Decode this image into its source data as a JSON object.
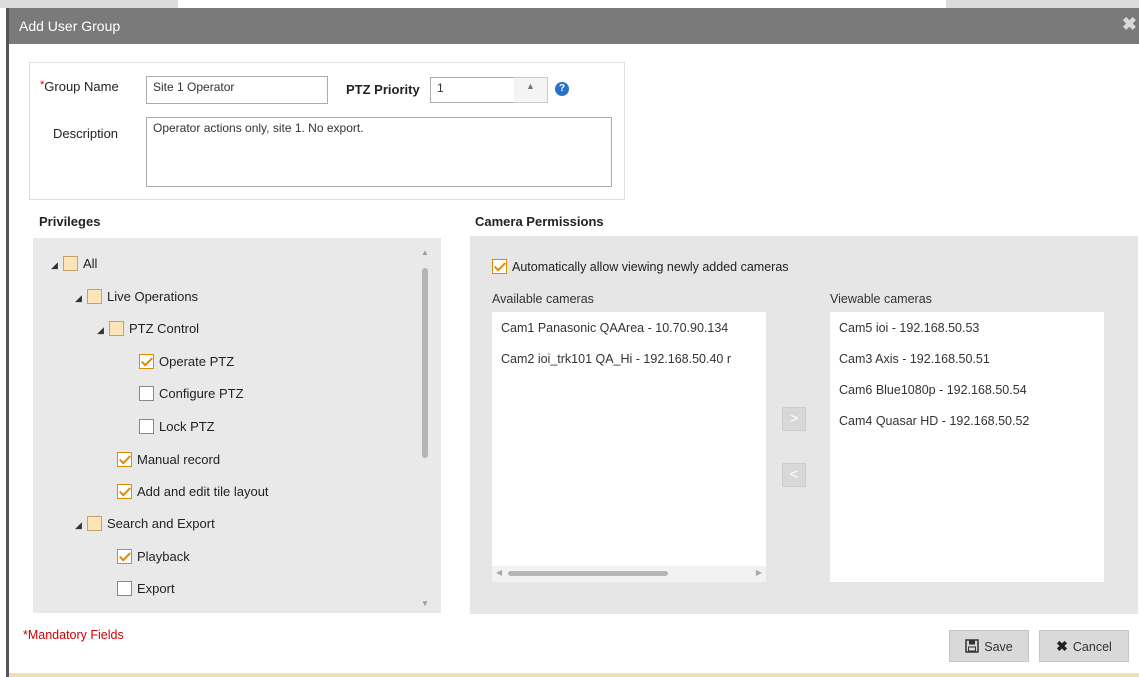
{
  "dialog": {
    "title": "Add User Group",
    "close_glyph": "✖"
  },
  "form": {
    "group_name_label": "Group Name",
    "required_mark": "*",
    "group_name_value": "Site 1 Operator",
    "ptz_priority_label": "PTZ Priority",
    "ptz_priority_value": "1",
    "description_label": "Description",
    "description_value": "Operator actions only, site 1. No export.",
    "help_glyph": "?"
  },
  "privileges": {
    "heading": "Privileges",
    "nodes": [
      {
        "label": "All",
        "state": "partial",
        "expanded": true
      },
      {
        "label": "Live Operations",
        "state": "partial",
        "expanded": true
      },
      {
        "label": "PTZ Control",
        "state": "partial",
        "expanded": true
      },
      {
        "label": "Operate PTZ",
        "state": "checked"
      },
      {
        "label": "Configure PTZ",
        "state": "unchecked"
      },
      {
        "label": "Lock PTZ",
        "state": "unchecked"
      },
      {
        "label": "Manual record",
        "state": "checked"
      },
      {
        "label": "Add and edit tile layout",
        "state": "checked"
      },
      {
        "label": "Search and Export",
        "state": "partial",
        "expanded": true
      },
      {
        "label": "Playback",
        "state": "checked"
      },
      {
        "label": "Export",
        "state": "unchecked"
      }
    ]
  },
  "camera_permissions": {
    "heading": "Camera Permissions",
    "auto_allow_label": "Automatically allow viewing newly added cameras",
    "auto_allow_checked": true,
    "available_label": "Available cameras",
    "viewable_label": "Viewable cameras",
    "available": [
      "Cam1 Panasonic QAArea - 10.70.90.134",
      "Cam2 ioi_trk101 QA_Hi - 192.168.50.40 r"
    ],
    "viewable": [
      "Cam5 ioi - 192.168.50.53",
      "Cam3 Axis - 192.168.50.51",
      "Cam6 Blue1080p - 192.168.50.54",
      "Cam4 Quasar HD - 192.168.50.52"
    ],
    "add_glyph": ">",
    "remove_glyph": "<"
  },
  "footer": {
    "mandatory_note": "*Mandatory Fields",
    "save_label": "Save",
    "cancel_label": "Cancel",
    "save_icon": "floppy-icon",
    "cancel_icon": "x-icon"
  },
  "colors": {
    "titlebar": "#7a7a7a",
    "accent_check": "#e08a00",
    "mandatory_text": "#d00000",
    "help_icon": "#2a72c8"
  }
}
